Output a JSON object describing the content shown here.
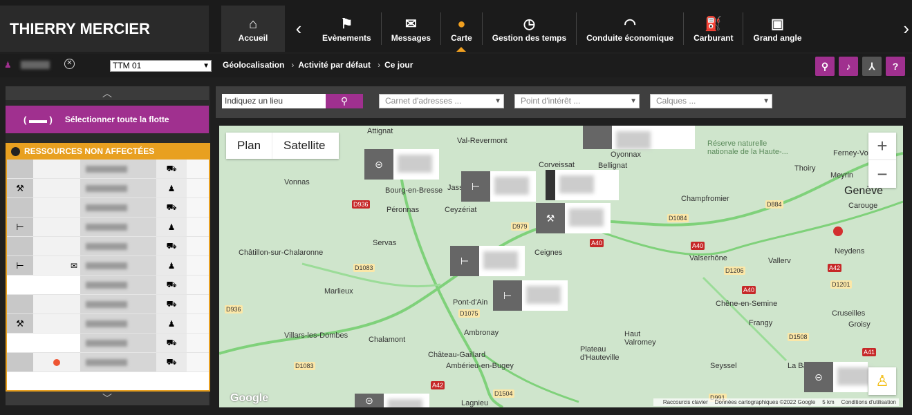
{
  "app": {
    "user_name": "THIERRY MERCIER"
  },
  "nav": {
    "items": [
      {
        "label": "Accueil",
        "icon": "home-icon"
      },
      {
        "label": "Evènements",
        "icon": "flag-icon"
      },
      {
        "label": "Messages",
        "icon": "mail-icon"
      },
      {
        "label": "Carte",
        "icon": "map-pin-icon"
      },
      {
        "label": "Gestion des temps",
        "icon": "clock-icon"
      },
      {
        "label": "Conduite économique",
        "icon": "gauge-icon"
      },
      {
        "label": "Carburant",
        "icon": "fuel-icon"
      },
      {
        "label": "Grand angle",
        "icon": "wide-angle-icon"
      }
    ]
  },
  "subbar": {
    "vehicle": "TTM 01",
    "crumbs": [
      "Géolocalisation",
      "Activité par défaut",
      "Ce jour"
    ]
  },
  "leftpanel": {
    "select_all": "Sélectionner toute la flotte",
    "group_title": "RESSOURCES NON AFFECTÉES"
  },
  "mapbar": {
    "place_placeholder": "Indiquez un lieu",
    "address_book": "Carnet d'adresses ...",
    "poi": "Point d'intérêt ...",
    "layers": "Calques ..."
  },
  "map": {
    "plan": "Plan",
    "satellite": "Satellite",
    "zoom_in": "+",
    "zoom_out": "−",
    "footer": [
      "Raccourcis clavier",
      "Données cartographiques ©2022 Google",
      "5 km",
      "Conditions d'utilisation"
    ],
    "logo": "Google",
    "places": [
      {
        "n": "Attignat"
      },
      {
        "n": "Val-Revermont"
      },
      {
        "n": "Corveissat"
      },
      {
        "n": "Bellignat"
      },
      {
        "n": "Oyonnax"
      },
      {
        "n": "Vonnas"
      },
      {
        "n": "Bourg-en-Bresse"
      },
      {
        "n": "Jasseron"
      },
      {
        "n": "Péronnas"
      },
      {
        "n": "Ceyzériat"
      },
      {
        "n": "Servas"
      },
      {
        "n": "Châtillon-sur-Chalaronne"
      },
      {
        "n": "Ceignes"
      },
      {
        "n": "Marlieux"
      },
      {
        "n": "Pont-d'Ain"
      },
      {
        "n": "Villars-les-Dombes"
      },
      {
        "n": "Ambronay"
      },
      {
        "n": "Chalamont"
      },
      {
        "n": "Château-Gaillard"
      },
      {
        "n": "Ambérieu-en-Bugey"
      },
      {
        "n": "Lagnieu"
      },
      {
        "n": "Champfromier"
      },
      {
        "n": "Valserhône"
      },
      {
        "n": "Vallerv"
      },
      {
        "n": "Chêne-en-Semine"
      },
      {
        "n": "Frangy"
      },
      {
        "n": "Haut Valromey"
      },
      {
        "n": "Plateau d'Hauteville"
      },
      {
        "n": "Seyssel"
      },
      {
        "n": "Genève"
      },
      {
        "n": "Carouge"
      },
      {
        "n": "Thoiry"
      },
      {
        "n": "Meyrin"
      },
      {
        "n": "Ferney-Voltaire"
      },
      {
        "n": "Neydens"
      },
      {
        "n": "Cruseilles"
      },
      {
        "n": "Groisy"
      },
      {
        "n": "La Bal"
      },
      {
        "n": "Réserve naturelle nationale de la Haute-..."
      }
    ],
    "roads": [
      "D936",
      "D979",
      "A40",
      "D1084",
      "A40",
      "D884",
      "D1083",
      "A40",
      "D1206",
      "A42",
      "D1201",
      "D1075",
      "D1083",
      "D1504",
      "D1508",
      "A41",
      "D991",
      "A42",
      "D936"
    ]
  }
}
